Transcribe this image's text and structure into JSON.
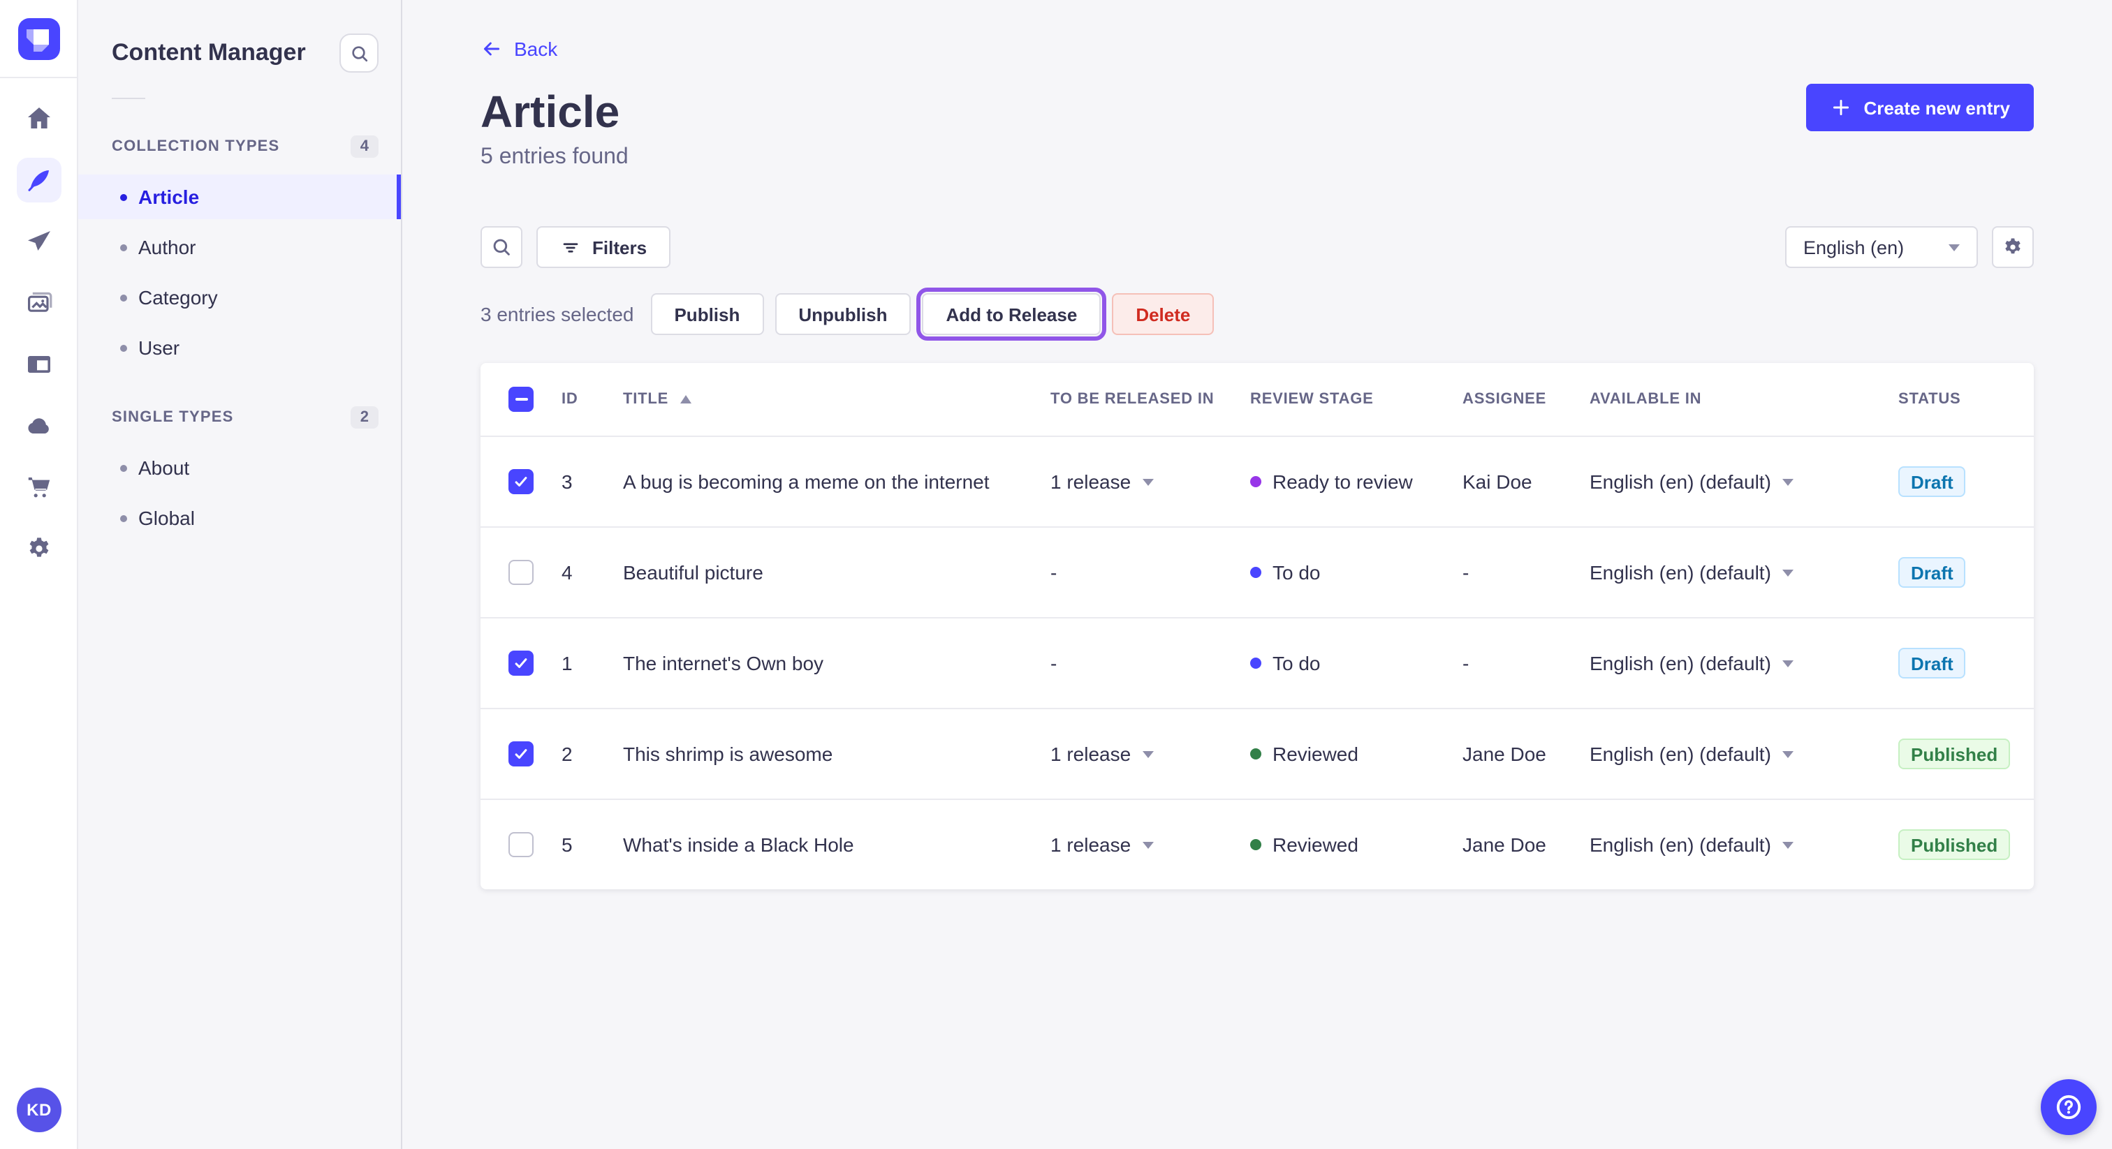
{
  "colors": {
    "accent": "#4945FF",
    "accent_dark": "#271FE0",
    "accent_bg": "#F0F0FF",
    "text": "#32324D",
    "muted": "#666687",
    "muted_light": "#8E8EA9",
    "border": "#DCDCE4",
    "border_light": "#EAEAEF",
    "page_bg": "#F6F6F9",
    "danger": "#D02B20",
    "danger_bg": "#FCECEA",
    "danger_border": "#F5C0B8",
    "draft_text": "#0C75AF",
    "draft_bg": "#EAF5FF",
    "draft_border": "#B8E1FF",
    "published_text": "#328048",
    "published_bg": "#EAFBE7",
    "published_border": "#C6F0C2",
    "release_outline": "#9056E8",
    "dot_todo": "#4945FF",
    "dot_ready": "#9736E8",
    "dot_reviewed": "#328048"
  },
  "nav_rail": {
    "logo_icon": "strapi-logo",
    "icons": [
      {
        "name": "home",
        "active": false
      },
      {
        "name": "content-manager",
        "active": true
      },
      {
        "name": "releases",
        "active": false
      },
      {
        "name": "media-library",
        "active": false
      },
      {
        "name": "content-type-builder",
        "active": false
      },
      {
        "name": "cloud",
        "active": false
      },
      {
        "name": "marketplace",
        "active": false
      },
      {
        "name": "settings",
        "active": false
      }
    ],
    "avatar_initials": "KD"
  },
  "subnav": {
    "title": "Content Manager",
    "sections": [
      {
        "label": "COLLECTION TYPES",
        "count": "4",
        "items": [
          {
            "label": "Article",
            "active": true
          },
          {
            "label": "Author",
            "active": false
          },
          {
            "label": "Category",
            "active": false
          },
          {
            "label": "User",
            "active": false
          }
        ]
      },
      {
        "label": "SINGLE TYPES",
        "count": "2",
        "items": [
          {
            "label": "About",
            "active": false
          },
          {
            "label": "Global",
            "active": false
          }
        ]
      }
    ]
  },
  "header": {
    "back_label": "Back",
    "title": "Article",
    "subtitle": "5 entries found",
    "create_label": "Create new entry"
  },
  "toolbar": {
    "filters_label": "Filters",
    "locale_value": "English (en)"
  },
  "selection": {
    "summary": "3 entries selected",
    "publish_label": "Publish",
    "unpublish_label": "Unpublish",
    "add_to_release_label": "Add to Release",
    "delete_label": "Delete"
  },
  "table": {
    "headers": {
      "id": "ID",
      "title": "TITLE",
      "released": "TO BE RELEASED IN",
      "review": "REVIEW STAGE",
      "assignee": "ASSIGNEE",
      "available": "AVAILABLE IN",
      "status": "STATUS"
    },
    "rows": [
      {
        "checked": true,
        "id": "3",
        "title": "A bug is becoming a meme on the internet",
        "released": "1 release",
        "review": "Ready to review",
        "review_key": "ready",
        "assignee": "Kai Doe",
        "available": "English (en) (default)",
        "status": "Draft",
        "status_key": "draft"
      },
      {
        "checked": false,
        "id": "4",
        "title": "Beautiful picture",
        "released": "-",
        "review": "To do",
        "review_key": "todo",
        "assignee": "-",
        "available": "English (en) (default)",
        "status": "Draft",
        "status_key": "draft"
      },
      {
        "checked": true,
        "id": "1",
        "title": "The internet's Own boy",
        "released": "-",
        "review": "To do",
        "review_key": "todo",
        "assignee": "-",
        "available": "English (en) (default)",
        "status": "Draft",
        "status_key": "draft"
      },
      {
        "checked": true,
        "id": "2",
        "title": "This shrimp is awesome",
        "released": "1 release",
        "review": "Reviewed",
        "review_key": "reviewed",
        "assignee": "Jane Doe",
        "available": "English (en) (default)",
        "status": "Published",
        "status_key": "published"
      },
      {
        "checked": false,
        "id": "5",
        "title": "What's inside a Black Hole",
        "released": "1 release",
        "review": "Reviewed",
        "review_key": "reviewed",
        "assignee": "Jane Doe",
        "available": "English (en) (default)",
        "status": "Published",
        "status_key": "published"
      }
    ]
  }
}
